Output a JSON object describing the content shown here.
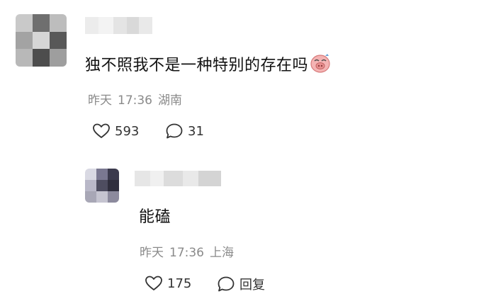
{
  "colors": {
    "text": "#111111",
    "meta": "#8a8a8a",
    "icon": "#333333",
    "background": "#ffffff"
  },
  "comments": [
    {
      "text": "独不照我不是一种特别的存在吗",
      "emoji": "pig-face-emoji",
      "meta": {
        "date": "昨天",
        "time": "17:36",
        "location": "湖南"
      },
      "likes": "593",
      "replies": "31"
    },
    {
      "text": "能磕",
      "meta": {
        "date": "昨天",
        "time": "17:36",
        "location": "上海"
      },
      "likes": "175",
      "reply_label": "回复"
    }
  ]
}
